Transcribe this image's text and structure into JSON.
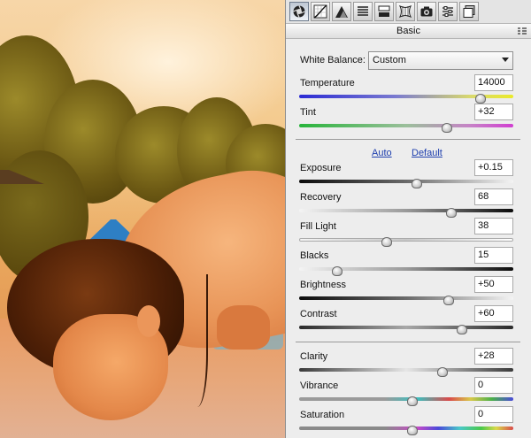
{
  "tool_tabs": [
    {
      "icon": "aperture-icon",
      "active": true
    },
    {
      "icon": "tone-curve-icon",
      "active": false
    },
    {
      "icon": "detail-triangle-icon",
      "active": false
    },
    {
      "icon": "hsl-grayscale-icon",
      "active": false
    },
    {
      "icon": "split-toning-icon",
      "active": false
    },
    {
      "icon": "lens-corrections-icon",
      "active": false
    },
    {
      "icon": "camera-calibration-icon",
      "active": false
    },
    {
      "icon": "presets-icon",
      "active": false
    },
    {
      "icon": "snapshots-icon",
      "active": false
    }
  ],
  "section_title": "Basic",
  "white_balance": {
    "label": "White Balance:",
    "selected": "Custom"
  },
  "temperature": {
    "label": "Temperature",
    "value": "14000",
    "level": 0.82
  },
  "tint": {
    "label": "Tint",
    "value": "+32",
    "level": 0.66
  },
  "auto_link": "Auto",
  "default_link": "Default",
  "exposure": {
    "label": "Exposure",
    "value": "+0.15",
    "level": 0.52
  },
  "recovery": {
    "label": "Recovery",
    "value": "68",
    "level": 0.68
  },
  "fill_light": {
    "label": "Fill Light",
    "value": "38",
    "level": 0.38
  },
  "blacks": {
    "label": "Blacks",
    "value": "15",
    "level": 0.15
  },
  "brightness": {
    "label": "Brightness",
    "value": "+50",
    "level": 0.67
  },
  "contrast": {
    "label": "Contrast",
    "value": "+60",
    "level": 0.73
  },
  "clarity": {
    "label": "Clarity",
    "value": "+28",
    "level": 0.64
  },
  "vibrance": {
    "label": "Vibrance",
    "value": "0",
    "level": 0.5
  },
  "saturation": {
    "label": "Saturation",
    "value": "0",
    "level": 0.5
  }
}
